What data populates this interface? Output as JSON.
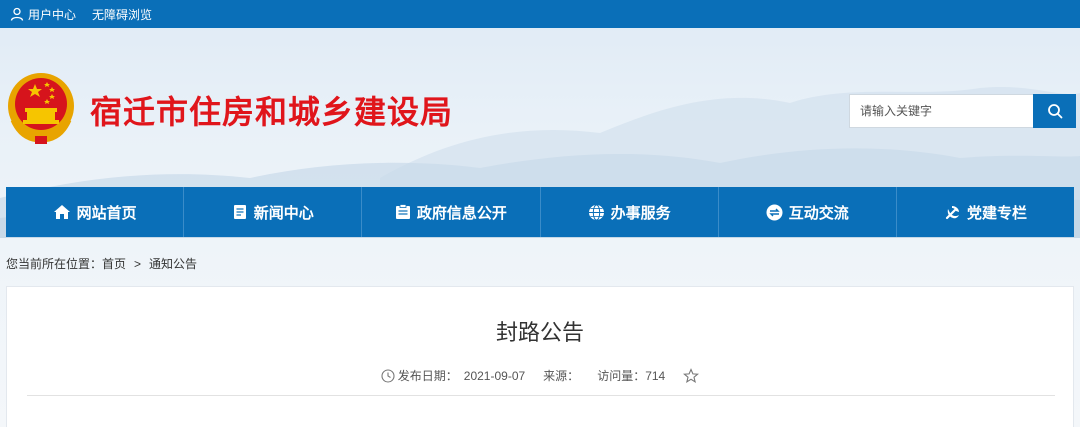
{
  "topbar": {
    "user_center": "用户中心",
    "accessibility": "无障碍浏览"
  },
  "header": {
    "site_title": "宿迁市住房和城乡建设局",
    "search_placeholder": "请输入关键字"
  },
  "nav": {
    "items": [
      {
        "label": "网站首页",
        "icon": "home-icon"
      },
      {
        "label": "新闻中心",
        "icon": "news-icon"
      },
      {
        "label": "政府信息公开",
        "icon": "document-icon"
      },
      {
        "label": "办事服务",
        "icon": "globe-icon"
      },
      {
        "label": "互动交流",
        "icon": "exchange-icon"
      },
      {
        "label": "党建专栏",
        "icon": "party-emblem-icon"
      }
    ]
  },
  "breadcrumb": {
    "prefix": "您当前所在位置：",
    "home": "首页",
    "separator": ">",
    "current": "通知公告"
  },
  "article": {
    "title": "封路公告",
    "date_label": "发布日期：",
    "date": "2021-09-07",
    "source_label": "来源：",
    "source": "",
    "views_label": "访问量：",
    "views": "714"
  },
  "colors": {
    "primary": "#0a6fb8",
    "title_red": "#e0151b"
  }
}
